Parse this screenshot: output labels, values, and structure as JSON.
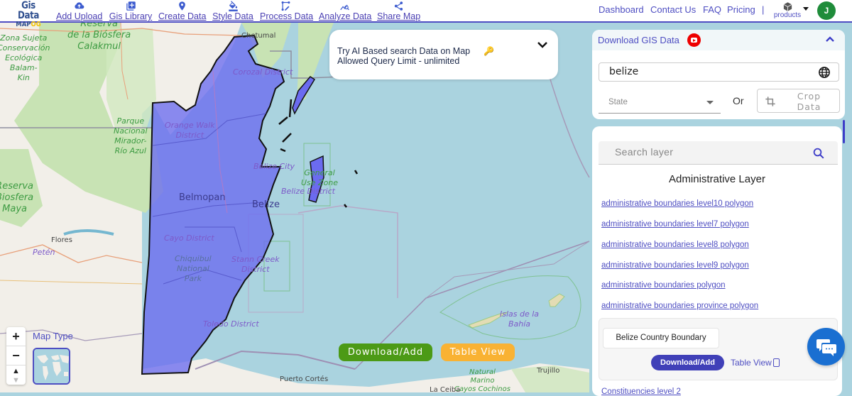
{
  "navbar": {
    "logo_line1": "Gis Data",
    "logo_line2_a": "MAP",
    "logo_line2_b": "OG",
    "items": [
      {
        "label": "Add Upload",
        "icon": "cloud-upload-icon"
      },
      {
        "label": "Gis Library",
        "icon": "library-add-icon"
      },
      {
        "label": "Create Data",
        "icon": "map-pin-icon"
      },
      {
        "label": "Style Data",
        "icon": "paint-bucket-icon"
      },
      {
        "label": "Process Data",
        "icon": "process-icon"
      },
      {
        "label": "Analyze Data",
        "icon": "analyze-icon"
      },
      {
        "label": "Share Map",
        "icon": "share-icon"
      }
    ],
    "right_links": [
      "Dashboard",
      "Contact Us",
      "FAQ",
      "Pricing"
    ],
    "separator": "|",
    "products_label": "products",
    "avatar_initial": "J",
    "accent_color": "#4e4ec2"
  },
  "ai_panel": {
    "line1": "Try AI Based search Data on Map",
    "line2": "Allowed Query Limit - unlimited",
    "key_icon": "🔑"
  },
  "map": {
    "labels": {
      "zona": "Zona Sujeta\nConservación\nEcológica\nBalam-\nKin",
      "reserva_calakmul": "Reserva\nde la Biósfera\nCalakmul",
      "chetumal": "Chetumal",
      "corozal": "Corozal District",
      "orange_walk": "Orange Walk\nDistrict",
      "parque": "Parque\nNacional\nMirador-\nRío Azul",
      "belize_city": "Belize City",
      "belize_district": "Belize District",
      "general_use": "General\nUse Zone",
      "reserva_maya": "Reserva\nBiosfera\nMaya",
      "belmopan": "Belmopan",
      "belize": "Belize",
      "flores": "Flores",
      "peten": "Petén",
      "cayo": "Cayo District",
      "chiquibul": "Chiquibul\nNational\nPark",
      "stann_creek": "Stann Creek\nDistrict",
      "toledo": "Toledo District",
      "islas": "Islas de la\nBahía",
      "natural_marino": "Natural\nMarino\nCayos Cochinos",
      "trujillo": "Trujillo",
      "puerto_cortes": "Puerto Cortés",
      "la_ceiba": "La Ceiba"
    },
    "zoom_in": "+",
    "zoom_out": "−",
    "compass": "▲",
    "map_type_label": "Map Type",
    "download_button": "Download/Add",
    "table_view_button": "Table View",
    "download_color": "#4c9a16",
    "table_view_color": "#f9b233",
    "highlight_color": "#6b6bf0"
  },
  "download_panel": {
    "title": "Download GIS Data",
    "country_value": "belize",
    "state_placeholder": "State",
    "or_label": "Or",
    "crop_label": "Crop\nData"
  },
  "layer_panel": {
    "search_placeholder": "Search layer",
    "section_title": "Administrative Layer",
    "layers": [
      "administrative boundaries level10 polygon",
      "administrative boundaries level7 polygon",
      "administrative boundaries level8 polygon",
      "administrative boundaries level9 polygon",
      "administrative boundaries polygon",
      "administrative boundaries province polygon"
    ],
    "selected_layer": "Belize Country Boundary",
    "selected_download": "Download/Add",
    "selected_table_view": "Table View",
    "next_section": "Constituencies level 2"
  }
}
